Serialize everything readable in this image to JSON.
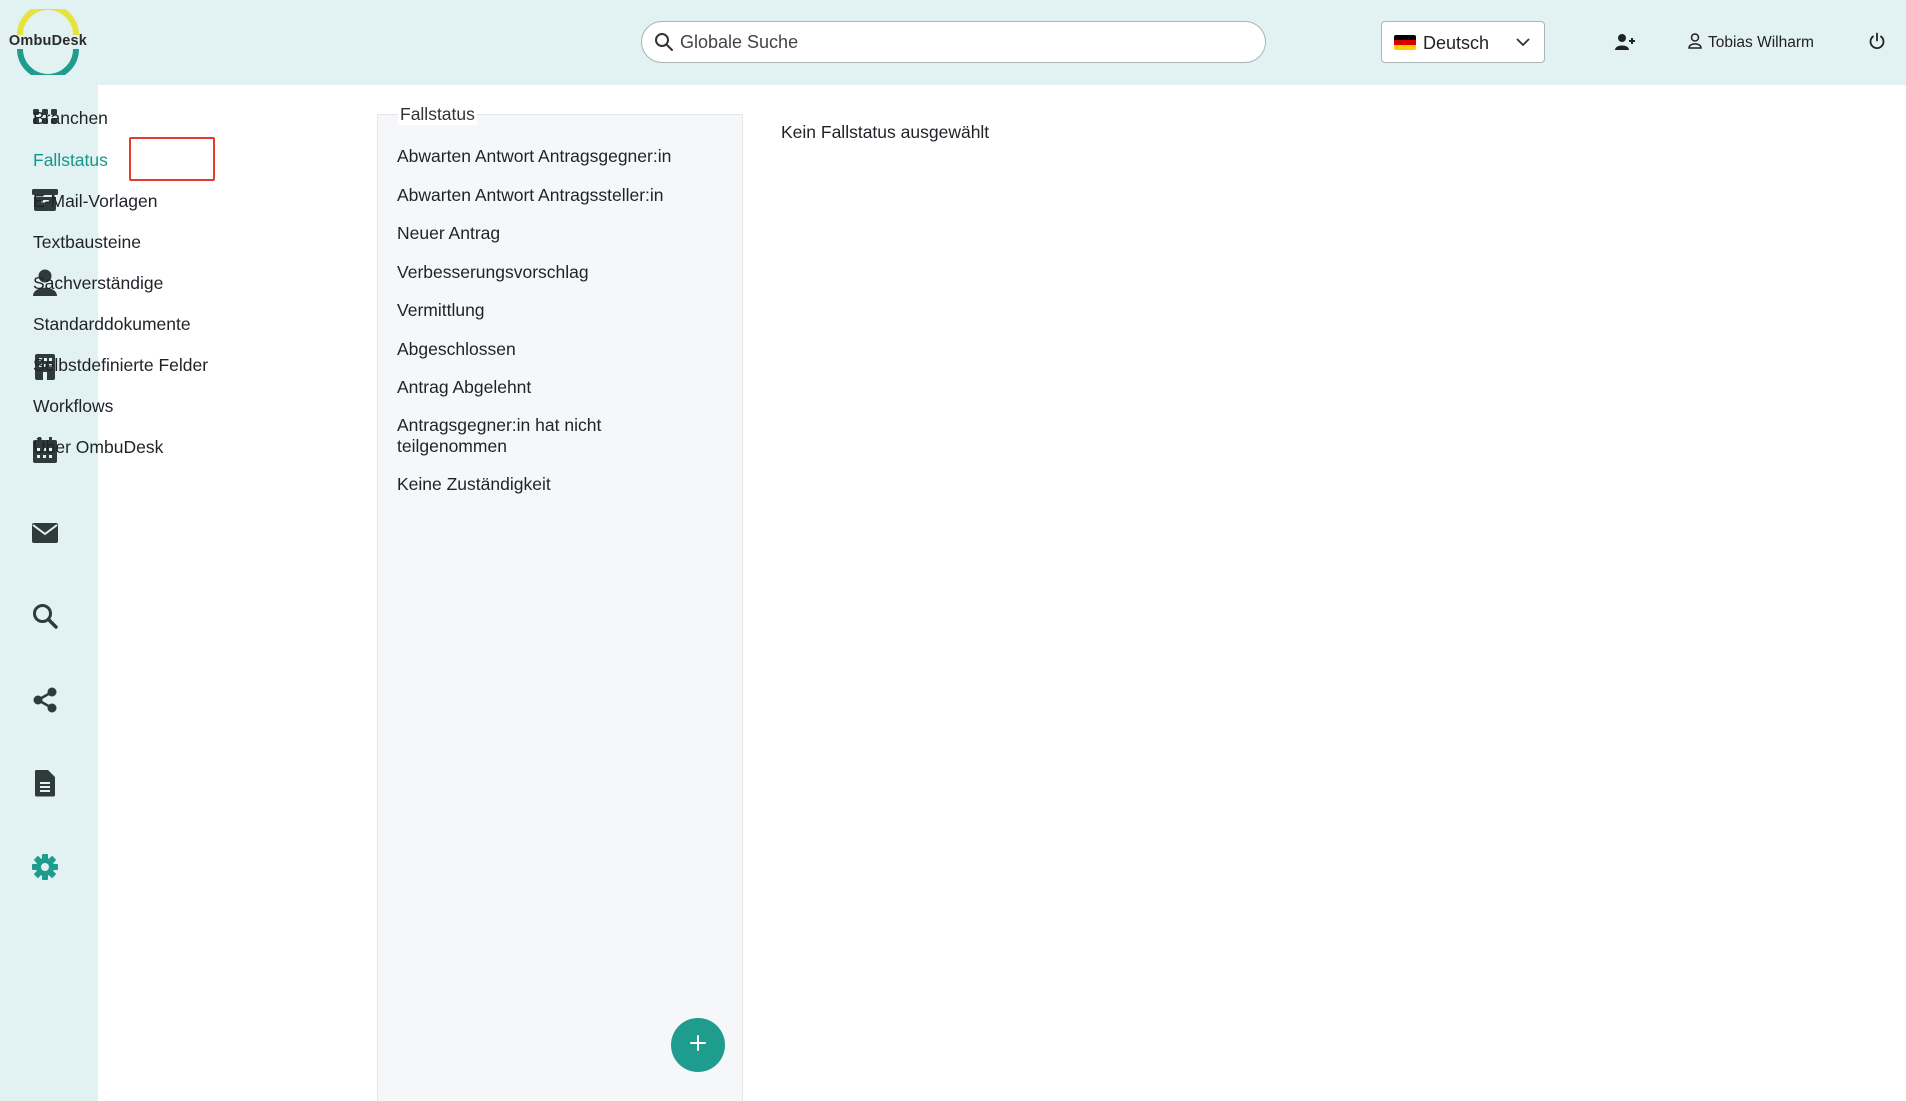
{
  "app": {
    "logo_text": "OmbuDesk"
  },
  "header": {
    "search": {
      "placeholder": "Globale Suche"
    },
    "language": {
      "selected": "Deutsch"
    },
    "user": {
      "name": "Tobias Wilharm"
    }
  },
  "rail": {
    "items": [
      {
        "name": "dashboard",
        "icon": "grid-icon"
      },
      {
        "name": "archive",
        "icon": "archive-icon"
      },
      {
        "name": "persons",
        "icon": "person-icon"
      },
      {
        "name": "organizations",
        "icon": "building-icon"
      },
      {
        "name": "calendar",
        "icon": "calendar-icon"
      },
      {
        "name": "mail",
        "icon": "envelope-icon"
      },
      {
        "name": "search",
        "icon": "search-icon"
      },
      {
        "name": "share",
        "icon": "share-icon"
      },
      {
        "name": "documents",
        "icon": "document-icon"
      },
      {
        "name": "settings",
        "icon": "gear-icon",
        "active": true
      }
    ]
  },
  "settings_menu": {
    "items": [
      {
        "label": "Branchen"
      },
      {
        "label": "Fallstatus",
        "active": true
      },
      {
        "label": "E-Mail-Vorlagen"
      },
      {
        "label": "Textbausteine"
      },
      {
        "label": "Sachverständige"
      },
      {
        "label": "Standarddokumente"
      },
      {
        "label": "Selbstdefinierte Felder"
      },
      {
        "label": "Workflows"
      },
      {
        "label": "Über OmbuDesk"
      }
    ]
  },
  "status_panel": {
    "title": "Fallstatus",
    "items": [
      "Abwarten Antwort Antragsgegner:in",
      "Abwarten Antwort Antragssteller:in",
      "Neuer Antrag",
      "Verbesserungsvorschlag",
      "Vermittlung",
      "Abgeschlossen",
      "Antrag Abgelehnt",
      "Antragsgegner:in hat nicht teilgenommen",
      "Keine Zuständigkeit"
    ]
  },
  "detail": {
    "empty_text": "Kein Fallstatus ausgewählt"
  },
  "colors": {
    "accent": "#15968c",
    "sidebar_bg": "#e2f1f1",
    "icon_dark": "#2f3b3b",
    "highlight_border": "#e23a2b"
  }
}
